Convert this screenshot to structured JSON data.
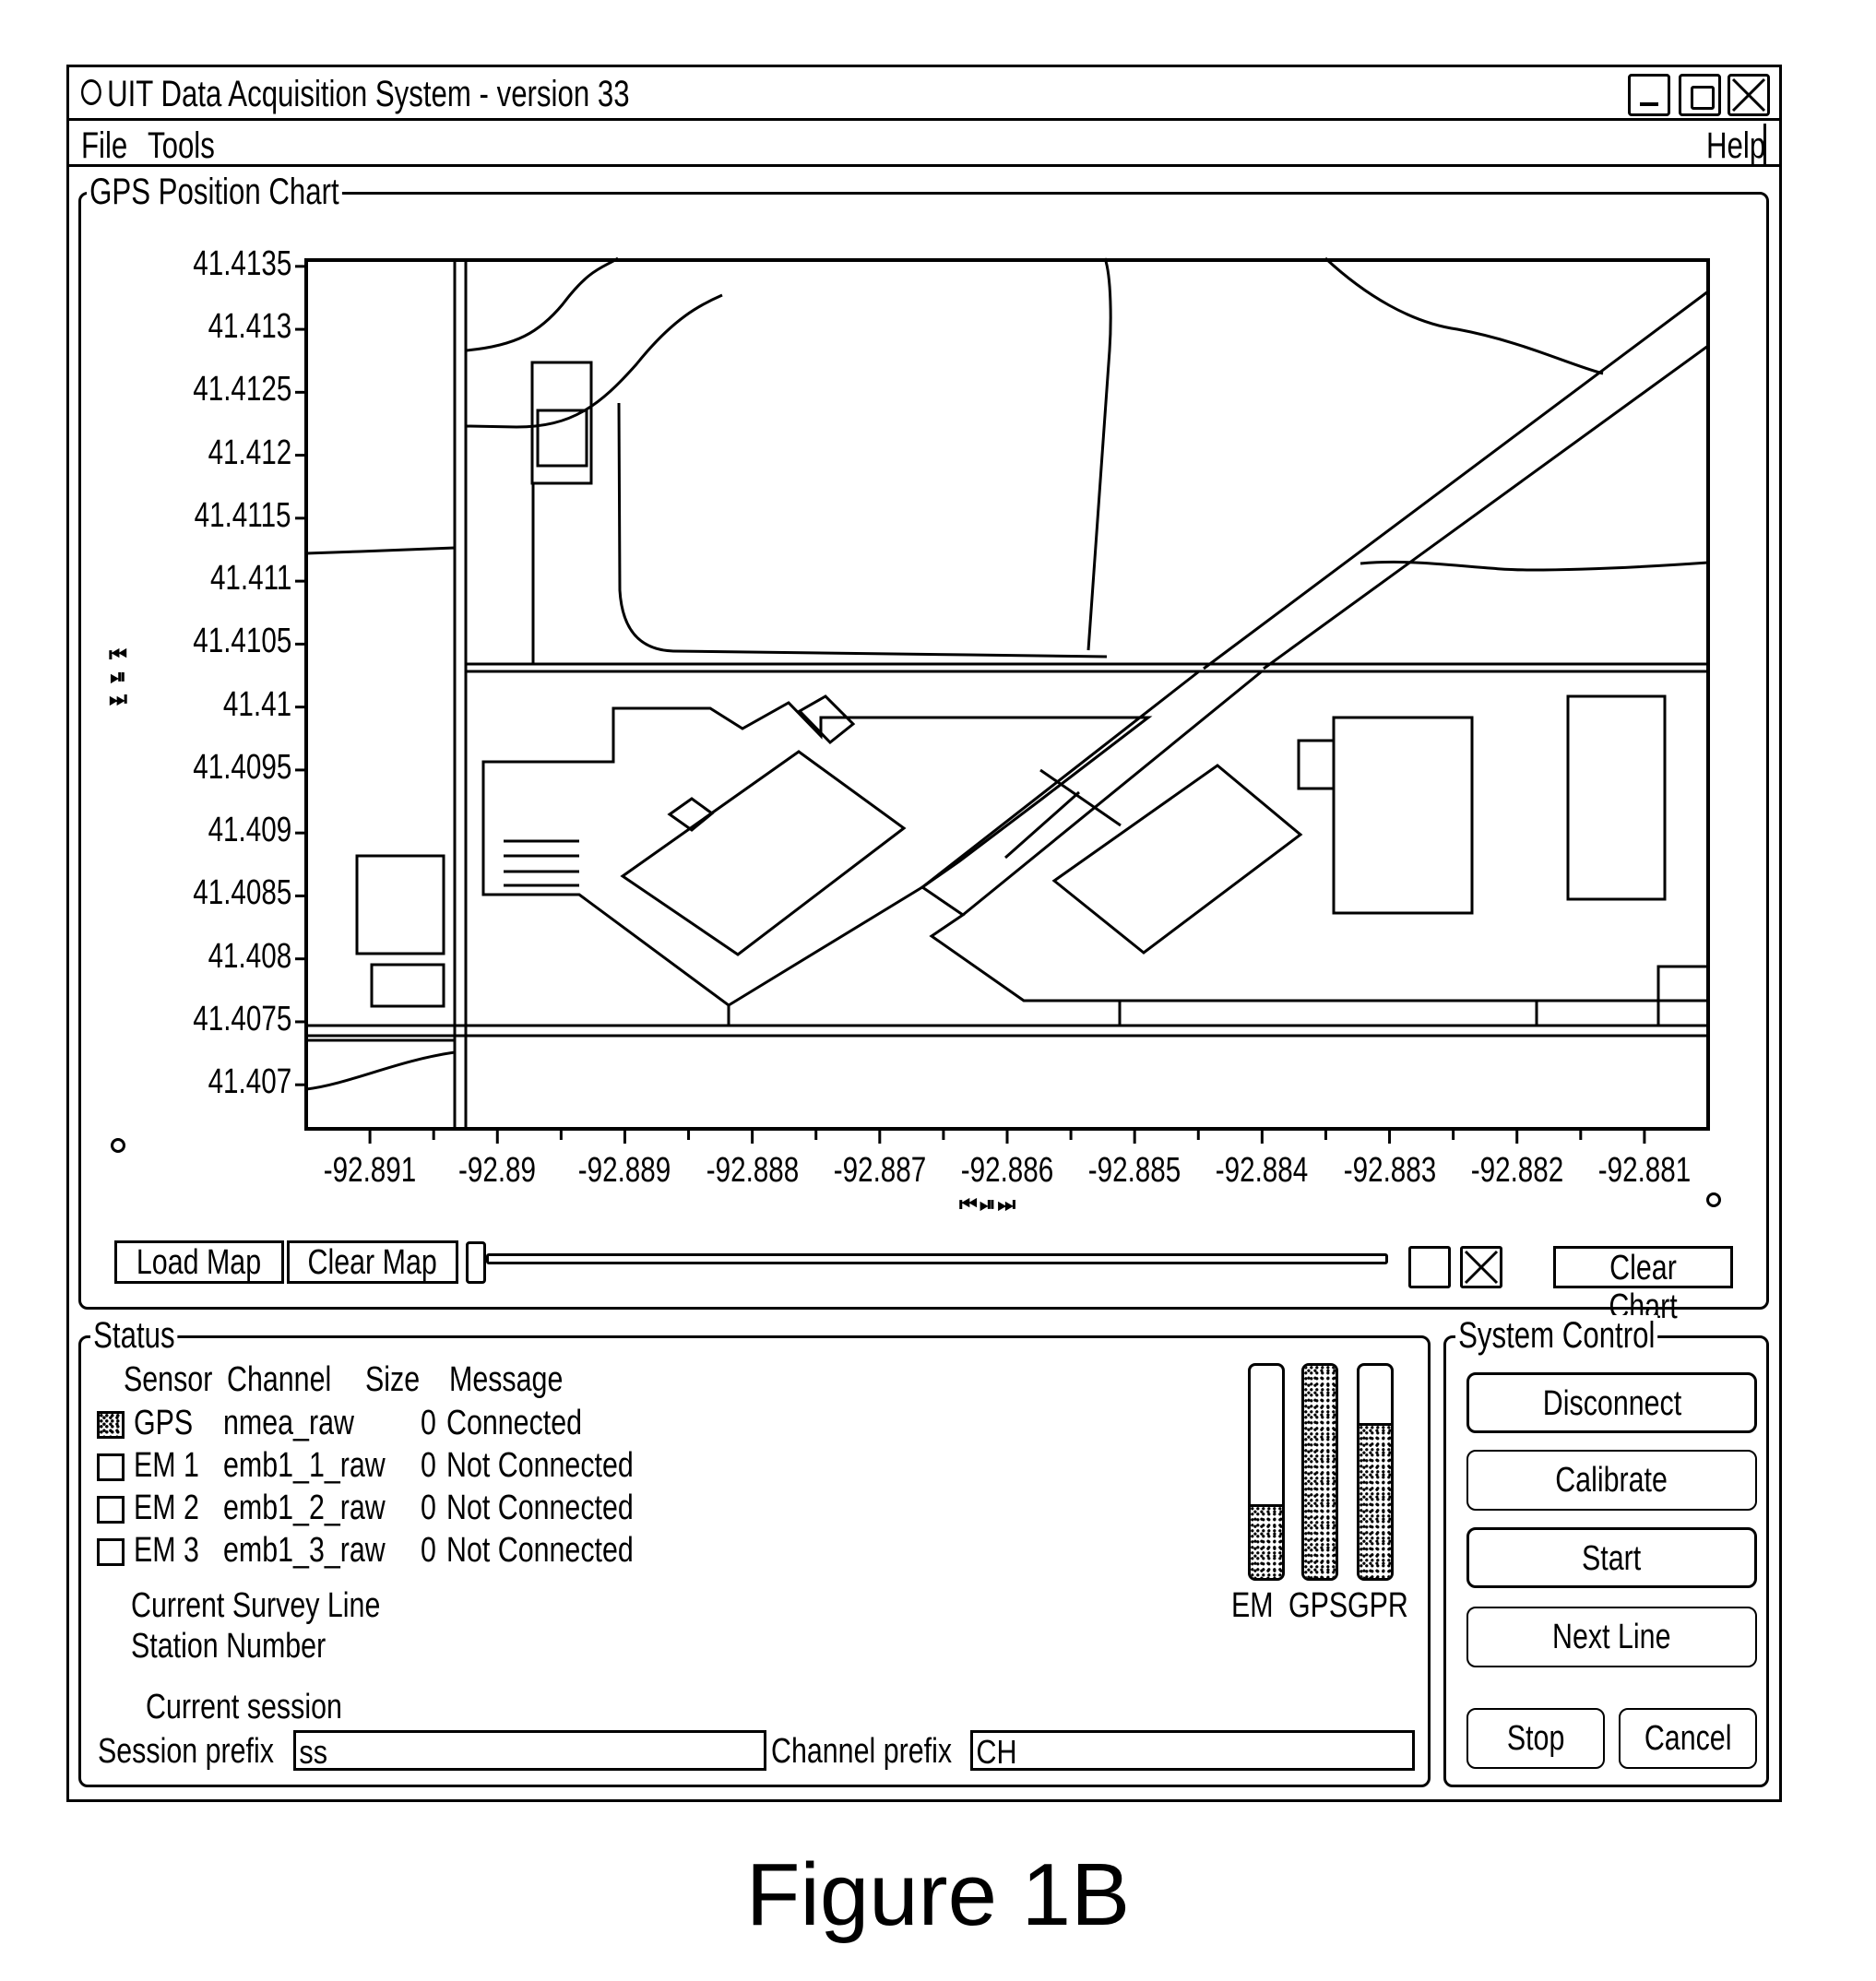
{
  "window": {
    "title": "UIT Data Acquisition System - version 33",
    "title_icon": "circle-icon",
    "controls": [
      "minimize",
      "maximize",
      "close"
    ]
  },
  "menu": {
    "left": [
      "File",
      "Tools"
    ],
    "right": "Help"
  },
  "gps_chart": {
    "group_title": "GPS Position Chart",
    "y_ticks": [
      "41.4135",
      "41.413",
      "41.4125",
      "41.412",
      "41.4115",
      "41.411",
      "41.4105",
      "41.41",
      "41.4095",
      "41.409",
      "41.4085",
      "41.408",
      "41.4075",
      "41.407"
    ],
    "x_ticks": [
      "-92.891",
      "-92.89",
      "-92.889",
      "-92.888",
      "-92.887",
      "-92.886",
      "-92.885",
      "-92.884",
      "-92.883",
      "-92.882",
      "-92.881"
    ],
    "y_scroll_icons": [
      "skip-start-icon",
      "step-icon",
      "skip-end-icon"
    ],
    "x_scroll_icons": [
      "skip-start-icon",
      "step-icon",
      "skip-end-icon"
    ],
    "buttons": {
      "load_map": "Load Map",
      "clear_map": "Clear Map",
      "clear_chart": "Clear Chart"
    },
    "slider_value": 0,
    "toggle_boxes": [
      {
        "name": "empty-box",
        "checked": false
      },
      {
        "name": "x-box",
        "checked": true
      }
    ]
  },
  "chart_data": {
    "type": "scatter",
    "title": "GPS Position Chart",
    "xlabel": "",
    "ylabel": "",
    "xlim": [
      -92.8915,
      -92.8805
    ],
    "ylim": [
      41.40665,
      41.41355
    ],
    "x_ticks": [
      -92.891,
      -92.89,
      -92.889,
      -92.888,
      -92.887,
      -92.886,
      -92.885,
      -92.884,
      -92.883,
      -92.882,
      -92.881
    ],
    "y_ticks": [
      41.4135,
      41.413,
      41.4125,
      41.412,
      41.4115,
      41.411,
      41.4105,
      41.41,
      41.4095,
      41.409,
      41.4085,
      41.408,
      41.4075,
      41.407
    ],
    "grid": false,
    "background": "site map line drawing (roads, buildings, parcels)",
    "series": []
  },
  "status": {
    "group_title": "Status",
    "headers": [
      "Sensor",
      "Channel",
      "Size",
      "Message"
    ],
    "rows": [
      {
        "active": true,
        "sensor": "GPS",
        "channel": "nmea_raw",
        "size": "0",
        "message": "Connected"
      },
      {
        "active": false,
        "sensor": "EM 1",
        "channel": "emb1_1_raw",
        "size": "0",
        "message": "Not Connected"
      },
      {
        "active": false,
        "sensor": "EM 2",
        "channel": "emb1_2_raw",
        "size": "0",
        "message": "Not Connected"
      },
      {
        "active": false,
        "sensor": "EM 3",
        "channel": "emb1_3_raw",
        "size": "0",
        "message": "Not Connected"
      }
    ],
    "survey_line_label": "Current Survey Line",
    "station_number_label": "Station Number",
    "current_session_label": "Current session",
    "session_prefix_label": "Session prefix",
    "session_prefix_value": "ss",
    "channel_prefix_label": "Channel prefix",
    "channel_prefix_value": "CH",
    "levels": [
      {
        "label": "EM",
        "fill_percent": 35
      },
      {
        "label": "GPS",
        "fill_percent": 100
      },
      {
        "label": "GPR",
        "fill_percent": 73
      }
    ]
  },
  "system_control": {
    "group_title": "System Control",
    "buttons": [
      "Disconnect",
      "Calibrate",
      "Start",
      "Next Line"
    ],
    "stop": "Stop",
    "cancel": "Cancel"
  },
  "caption": "Figure 1B"
}
